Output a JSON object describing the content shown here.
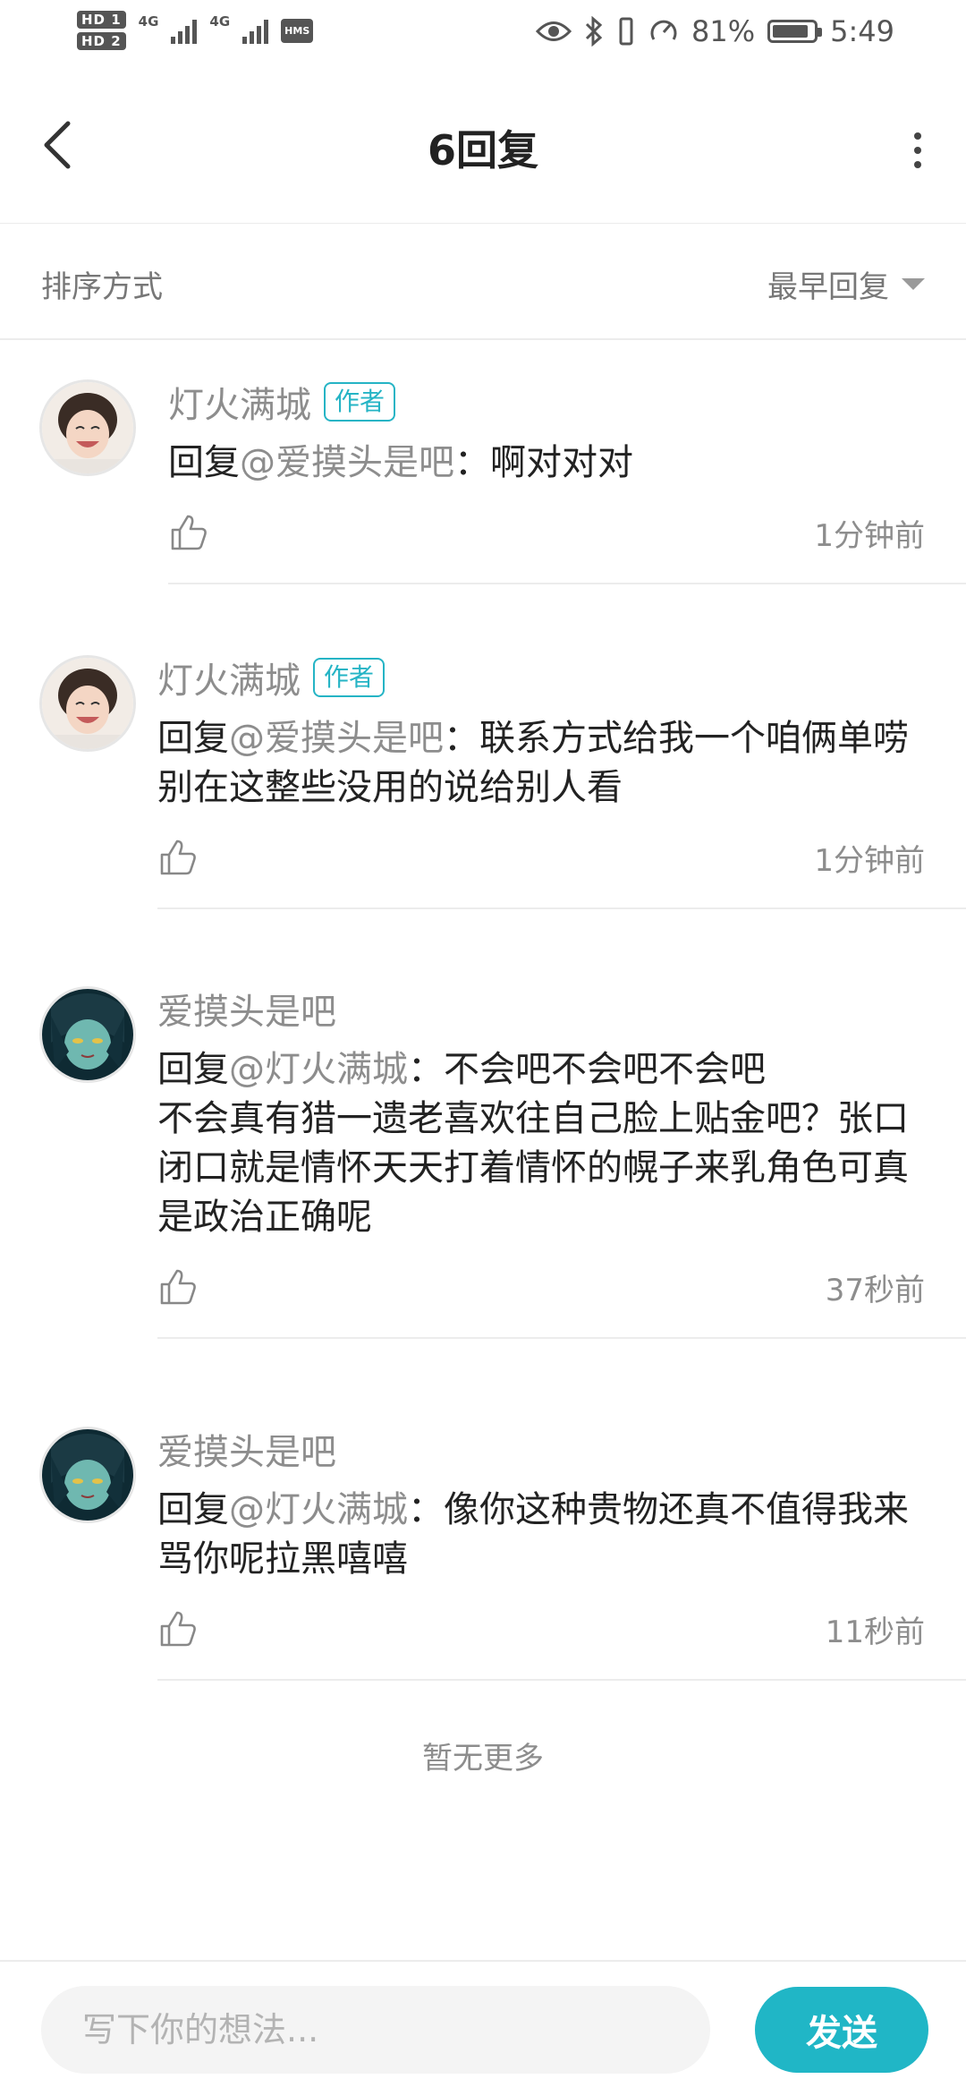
{
  "status_bar": {
    "sim1": "HD 1",
    "sim2": "HD 2",
    "network1": "4G",
    "network2": "4G",
    "hms": "HMS",
    "battery_percent": "81%",
    "time": "5:49"
  },
  "header": {
    "title": "6回复",
    "back_icon": "chevron-left-icon",
    "more_icon": "more-vertical-icon"
  },
  "sort": {
    "label": "排序方式",
    "selected": "最早回复"
  },
  "comments": [
    {
      "author": "灯火满城",
      "badge": "作者",
      "reply_prefix": "回复",
      "mention": "@爱摸头是吧",
      "colon": "：",
      "content": "啊对对对",
      "time": "1分钟前"
    },
    {
      "author": "灯火满城",
      "badge": "作者",
      "reply_prefix": "回复",
      "mention": "@爱摸头是吧",
      "colon": "：",
      "content": "联系方式给我一个咱俩单唠  别在这整些没用的说给别人看",
      "time": "1分钟前"
    },
    {
      "author": "爱摸头是吧",
      "badge": "",
      "reply_prefix": "回复",
      "mention": "@灯火满城",
      "colon": "：",
      "content": "不会吧不会吧不会吧\n不会真有猎一遗老喜欢往自己脸上贴金吧？张口闭口就是情怀天天打着情怀的幌子来乳角色可真是政治正确呢",
      "time": "37秒前"
    },
    {
      "author": "爱摸头是吧",
      "badge": "",
      "reply_prefix": "回复",
      "mention": "@灯火满城",
      "colon": "：",
      "content": "像你这种贵物还真不值得我来骂你呢拉黑嘻嘻",
      "time": "11秒前"
    }
  ],
  "footer_text": "暂无更多",
  "input": {
    "placeholder": "写下你的想法...",
    "value": ""
  },
  "send_button": "发送",
  "colors": {
    "accent": "#20b6c6",
    "badge": "#25b4c5",
    "muted_text": "#8d8d8d"
  }
}
